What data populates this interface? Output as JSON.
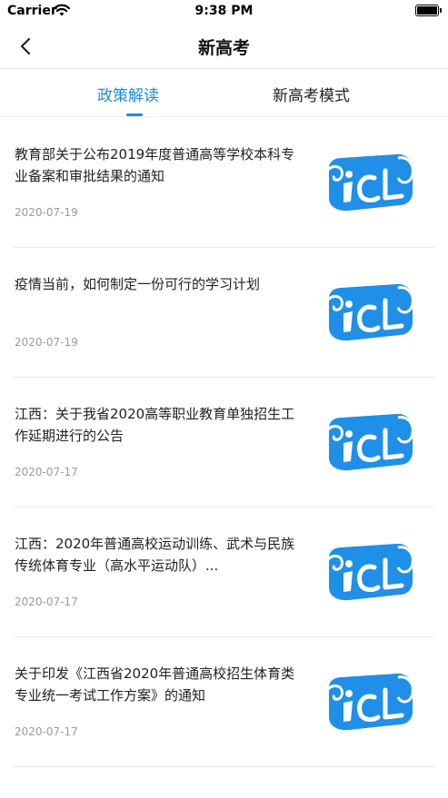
{
  "status_bar": {
    "carrier": "Carrier",
    "time": "9:38 PM"
  },
  "nav": {
    "title": "新高考"
  },
  "tabs": [
    {
      "label": "政策解读",
      "active": true
    },
    {
      "label": "新高考模式",
      "active": false
    }
  ],
  "colors": {
    "accent": "#1e8be0",
    "thumb_blue": "#1f8fe8"
  },
  "news": [
    {
      "title": "教育部关于公布2019年度普通高等学校本科专业备案和审批结果的通知",
      "date": "2020-07-19"
    },
    {
      "title": "疫情当前，如何制定一份可行的学习计划",
      "date": "2020-07-19"
    },
    {
      "title": "江西：关于我省2020高等职业教育单独招生工作延期进行的公告",
      "date": "2020-07-17"
    },
    {
      "title": "江西：2020年普通高校运动训练、武术与民族传统体育专业（高水平运动队）...",
      "date": "2020-07-17"
    },
    {
      "title": "关于印发《江西省2020年普通高校招生体育类专业统一考试工作方案》的通知",
      "date": "2020-07-17"
    }
  ]
}
